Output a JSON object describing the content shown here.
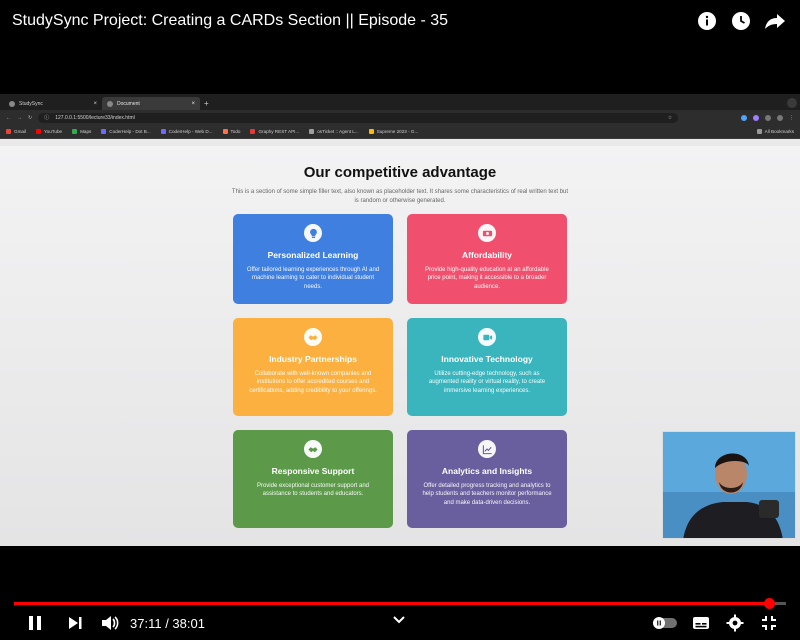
{
  "youtube": {
    "title": "StudySync Project: Creating a CARDs Section || Episode - 35",
    "time_current": "37:11",
    "time_separator": " / ",
    "time_total": "38:01",
    "progress_fraction": 0.9776,
    "accent": "#ff0000"
  },
  "browser": {
    "tabs": [
      {
        "label": "StudySync",
        "active": false
      },
      {
        "label": "Document",
        "active": true
      }
    ],
    "url": "127.0.0.1:5500/lecture33/index.html",
    "bookmarks": [
      {
        "label": "Gmail",
        "color": "#ea4335"
      },
      {
        "label": "YouTube",
        "color": "#ff0000"
      },
      {
        "label": "Maps",
        "color": "#34a853"
      },
      {
        "label": "CoderHelp - Dot B...",
        "color": "#6b6bff"
      },
      {
        "label": "CoderHelp - Web D...",
        "color": "#6b6bff"
      },
      {
        "label": "Todo",
        "color": "#ff7043"
      },
      {
        "label": "Graphy REST API...",
        "color": "#e53935"
      },
      {
        "label": "osTicket :: Agent L...",
        "color": "#9e9e9e"
      },
      {
        "label": "Supreme 2023 - G...",
        "color": "#fbbc04"
      }
    ],
    "all_bookmarks": "All Bookmarks"
  },
  "page": {
    "title": "Our competitive advantage",
    "subtitle": "This is a section of some simple filler text, also known as placeholder text. It shares some characteristics of real written text but is random or otherwise generated."
  },
  "cards": [
    {
      "title": "Personalized Learning",
      "desc": "Offer tailored learning experiences through AI and machine learning to cater to individual student needs.",
      "color": "#3f7fe0",
      "icon": "lightbulb-icon"
    },
    {
      "title": "Affordability",
      "desc": "Provide high-quality education at an affordable price point, making it accessible to a broader audience.",
      "color": "#f0506e",
      "icon": "money-icon"
    },
    {
      "title": "Industry Partnerships",
      "desc": "Collaborate with well-known companies and institutions to offer accredited courses and certifications, adding credibility to your offerings.",
      "color": "#fbb040",
      "icon": "handshake-icon"
    },
    {
      "title": "Innovative Technology",
      "desc": "Utilize cutting-edge technology, such as augmented reality or virtual reality, to create immersive learning experiences.",
      "color": "#3bb5bd",
      "icon": "video-icon"
    },
    {
      "title": "Responsive Support",
      "desc": "Provide exceptional customer support and assistance to students and educators.",
      "color": "#5c9a4a",
      "icon": "handshake-icon"
    },
    {
      "title": "Analytics and Insights",
      "desc": "Offer detailed progress tracking and analytics to help students and teachers monitor performance and make data-driven decisions.",
      "color": "#6a5f9e",
      "icon": "chart-icon"
    }
  ]
}
